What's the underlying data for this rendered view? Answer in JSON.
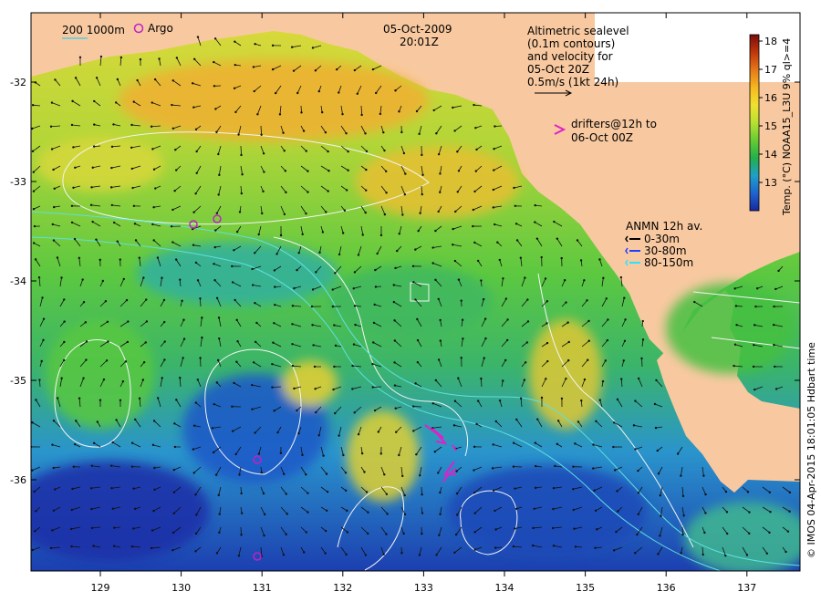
{
  "title": {
    "date": "05-Oct-2009",
    "time": "20:01Z"
  },
  "scale_legend": {
    "contours": "200  1000m",
    "argo": "Argo"
  },
  "altimetry_note": [
    "Altimetric sealevel",
    "(0.1m contours)",
    "and velocity for",
    "05-Oct 20Z",
    "0.5m/s (1kt 24h)"
  ],
  "drifters_note": [
    "drifters@12h to",
    "06-Oct 00Z"
  ],
  "anmn": {
    "title": "ANMN 12h av.",
    "items": [
      {
        "label": "0-30m",
        "color": "#000000"
      },
      {
        "label": "30-80m",
        "color": "#1f3fff"
      },
      {
        "label": "80-150m",
        "color": "#22e6ff"
      }
    ]
  },
  "colorbar": {
    "label": "Temp. (°C) NOAA15_L3U 9% ql>=4",
    "ticks": [
      "18",
      "17",
      "16",
      "15",
      "14",
      "13"
    ],
    "colors": [
      "#7a0c0c",
      "#c0360c",
      "#e6781a",
      "#f5b820",
      "#f0e030",
      "#b8e030",
      "#66cc33",
      "#22b04a",
      "#1ea0c8",
      "#1e64d2",
      "#16289e"
    ]
  },
  "credit": "© IMOS 04-Apr-2015 18:01:05 Hdbart time",
  "x_ticks": [
    "129",
    "130",
    "131",
    "132",
    "133",
    "134",
    "135",
    "136",
    "137"
  ],
  "y_ticks": [
    "-32",
    "-33",
    "-34",
    "-35",
    "-36"
  ]
}
